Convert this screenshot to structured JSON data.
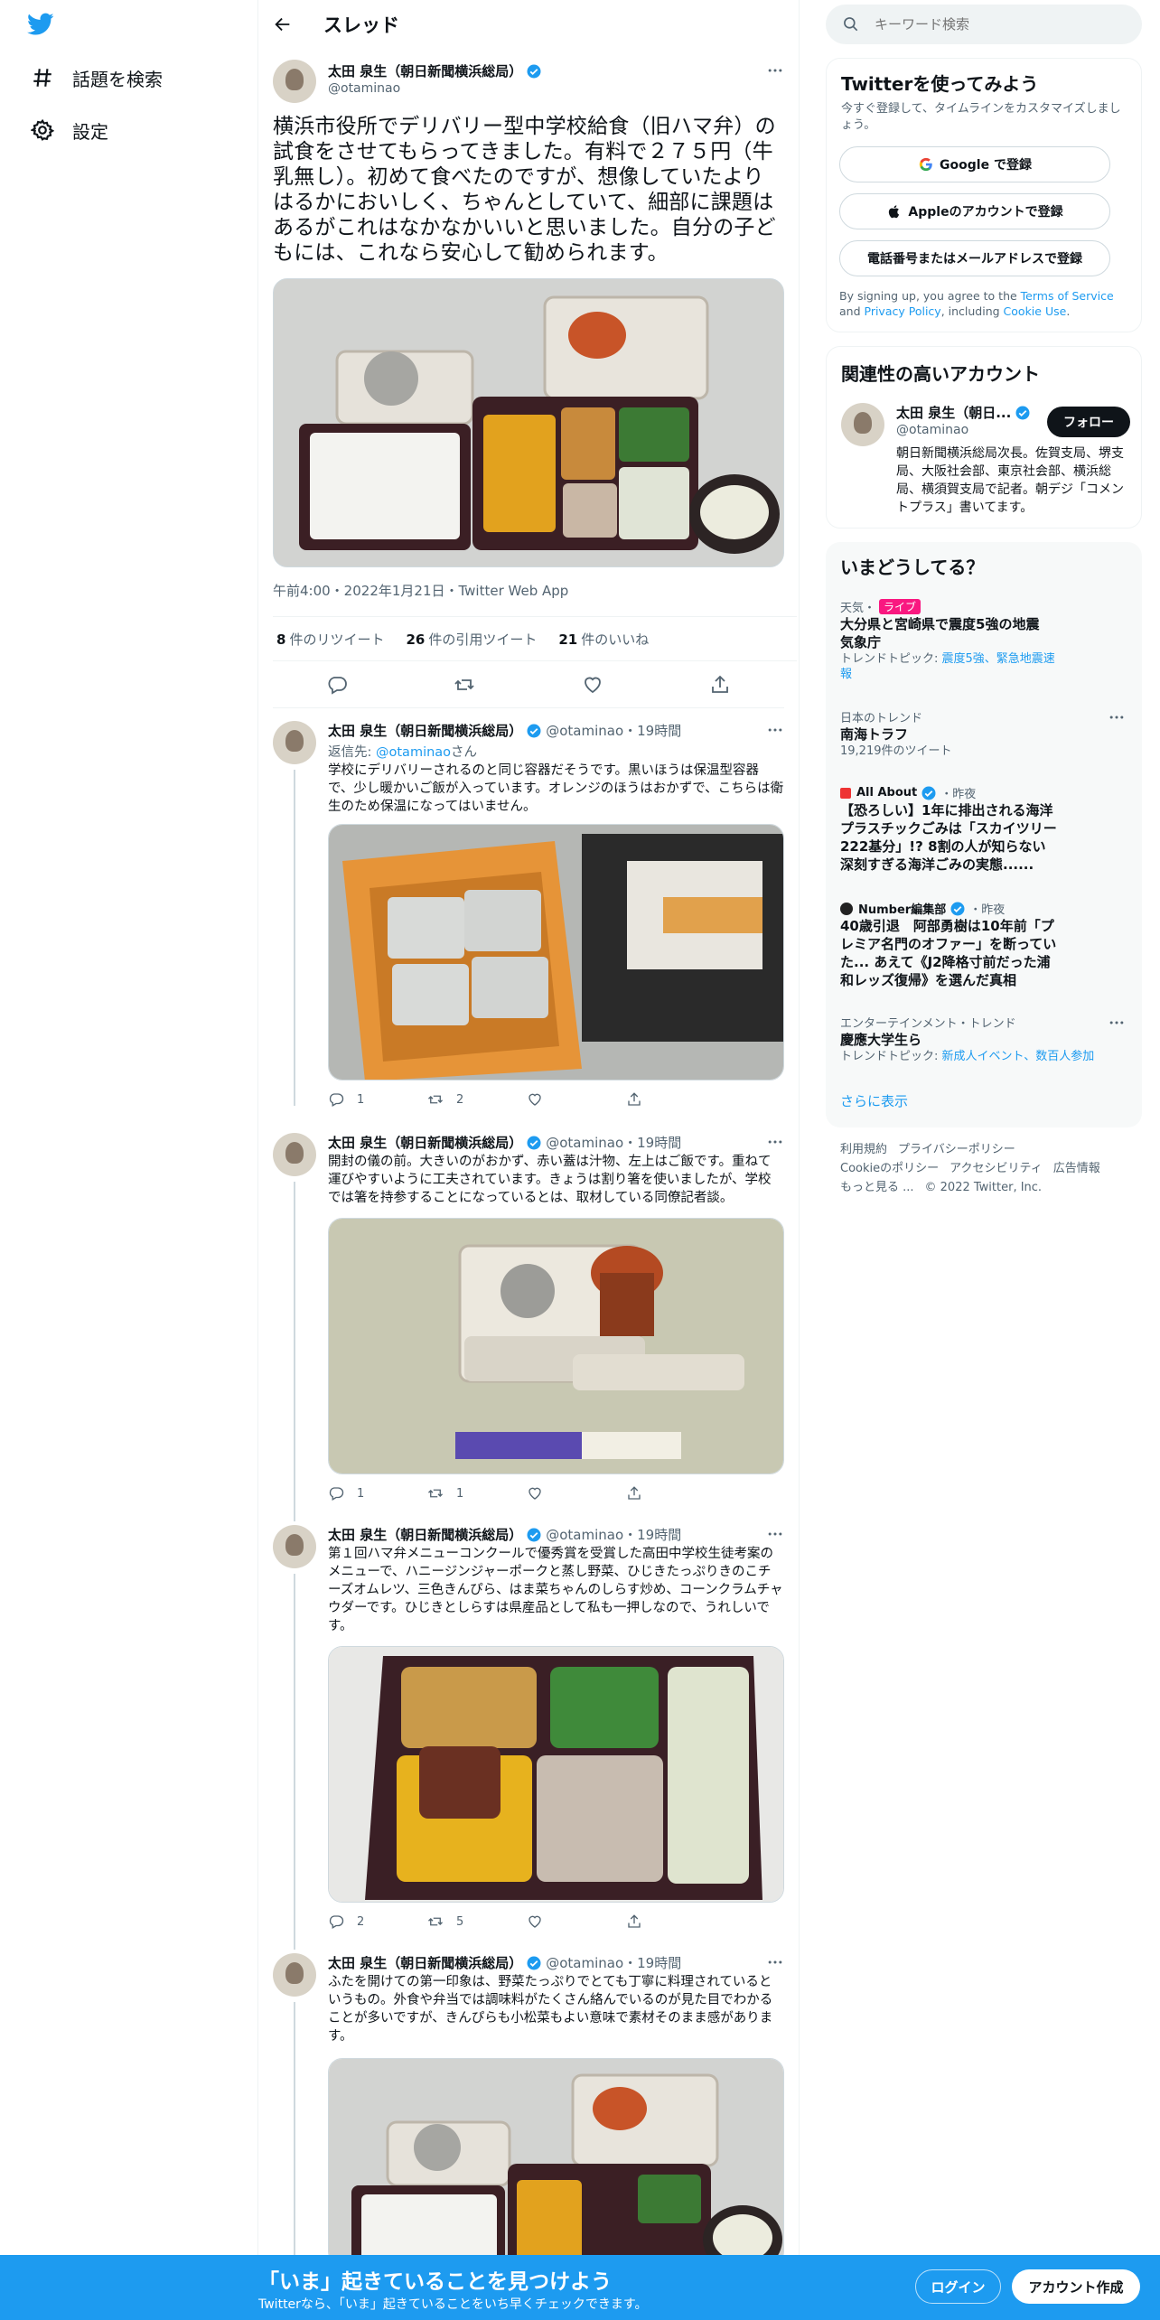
{
  "nav": {
    "explore_label": "話題を検索",
    "settings_label": "設定"
  },
  "header": {
    "title": "スレッド"
  },
  "main_tweet": {
    "author_name": "太田 泉生（朝日新聞横浜総局）",
    "handle": "@otaminao",
    "text": "横浜市役所でデリバリー型中学校給食（旧ハマ弁）の試食をさせてもらってきました。有料で２７５円（牛乳無し）。初めて食べたのですが、想像していたよりはるかにおいしく、ちゃんとしていて、細部に課題はあるがこれはなかなかいいと思いました。自分の子どもには、これなら安心して勧められます。",
    "meta": "午前4:00・2022年1月21日・Twitter Web App",
    "retweets_count": "8",
    "retweets_label": "件のリツイート",
    "quotes_count": "26",
    "quotes_label": "件の引用ツイート",
    "likes_count": "21",
    "likes_label": "件のいいね"
  },
  "replies": [
    {
      "author_name": "太田 泉生（朝日新聞横浜総局）",
      "handle": "@otaminao",
      "time": "・19時間",
      "reply_to_prefix": "返信先: ",
      "reply_to_handle": "@otaminao",
      "reply_to_suffix": "さん",
      "text": "学校にデリバリーされるのと同じ容器だそうです。黒いほうは保温型容器で、少し暖かいご飯が入っています。オレンジのほうはおかずで、こちらは衛生のため保温になってはいません。",
      "replies": "1",
      "retweets": "2",
      "likes": ""
    },
    {
      "author_name": "太田 泉生（朝日新聞横浜総局）",
      "handle": "@otaminao",
      "time": "・19時間",
      "text": "開封の儀の前。大きいのがおかず、赤い蓋は汁物、左上はご飯です。重ねて運びやすいように工夫されています。きょうは割り箸を使いましたが、学校では箸を持参することになっているとは、取材している同僚記者談。",
      "replies": "1",
      "retweets": "1",
      "likes": ""
    },
    {
      "author_name": "太田 泉生（朝日新聞横浜総局）",
      "handle": "@otaminao",
      "time": "・19時間",
      "text": "第１回ハマ弁メニューコンクールで優秀賞を受賞した高田中学校生徒考案のメニューで、ハニージンジャーポークと蒸し野菜、ひじきたっぷりきのこチーズオムレツ、三色きんぴら、はま菜ちゃんのしらす炒め、コーンクラムチャウダーです。ひじきとしらすは県産品として私も一押しなので、うれしいです。",
      "replies": "2",
      "retweets": "5",
      "likes": ""
    },
    {
      "author_name": "太田 泉生（朝日新聞横浜総局）",
      "handle": "@otaminao",
      "time": "・19時間",
      "text": "ふたを開けての第一印象は、野菜たっぷりでとても丁寧に料理されているというもの。外食や弁当では調味料がたくさん絡んでいるのが見た目でわかることが多いですが、きんぴらも小松菜もよい意味で素材そのまま感があります。"
    }
  ],
  "search": {
    "placeholder": "キーワード検索"
  },
  "signup": {
    "title": "Twitterを使ってみよう",
    "subtitle": "今すぐ登録して、タイムラインをカスタマイズしましょう。",
    "google_label": "Google で登録",
    "apple_label": "Appleのアカウントで登録",
    "phone_label": "電話番号またはメールアドレスで登録",
    "terms_prefix": "By signing up, you agree to the ",
    "terms_tos": "Terms of Service",
    "terms_and": " and ",
    "terms_privacy": "Privacy Policy",
    "terms_including": ", including ",
    "terms_cookie": "Cookie Use",
    "terms_end": "."
  },
  "related": {
    "title": "関連性の高いアカウント",
    "name": "太田 泉生（朝日...",
    "handle": "@otaminao",
    "follow_label": "フォロー",
    "bio": "朝日新聞横浜総局次長。佐賀支局、堺支局、大阪社会部、東京社会部、横浜総局、横須賀支局で記者。朝デジ「コメントプラス」書いてます。"
  },
  "trends": {
    "title": "いまどうしてる？",
    "items": [
      {
        "context": "天気・",
        "live": "ライブ",
        "title": "大分県と宮崎県で震度5強の地震　気象庁",
        "extra_prefix": "トレンドトピック: ",
        "extra_links": "震度5強、緊急地震速報"
      },
      {
        "context": "日本のトレンド",
        "title": "南海トラフ",
        "extra": "19,219件のツイート"
      },
      {
        "source": "All About",
        "time": "・昨夜",
        "title": "【恐ろしい】1年に排出される海洋プラスチックごみは「スカイツリー222基分」!? 8割の人が知らない深刻すぎる海洋ごみの実態......"
      },
      {
        "source": "Number編集部",
        "time": "・昨夜",
        "title": "40歳引退　阿部勇樹は10年前「プレミア名門のオファー」を断っていた... あえて《J2降格寸前だった浦和レッズ復帰》を選んだ真相"
      },
      {
        "context": "エンターテインメント・トレンド",
        "title": "慶應大学生ら",
        "extra_prefix": "トレンドトピック: ",
        "extra_links": "新成人イベント、数百人参加"
      }
    ],
    "show_more": "さらに表示"
  },
  "footer": {
    "links": [
      "利用規約",
      "プライバシーポリシー",
      "Cookieのポリシー",
      "アクセシビリティ",
      "広告情報",
      "もっと見る ..."
    ],
    "copyright": "© 2022 Twitter, Inc."
  },
  "bottom_bar": {
    "title": "「いま」起きていることを見つけよう",
    "subtitle": "Twitterなら、「いま」起きていることをいち早くチェックできます。",
    "login_label": "ログイン",
    "signup_label": "アカウント作成"
  },
  "colors": {
    "accent": "#1d9bf0",
    "live": "#f91880",
    "text": "#0f1419",
    "muted": "#536471"
  },
  "icons": [
    "twitter-bird",
    "hashtag",
    "gear",
    "back-arrow",
    "verified-badge",
    "more",
    "reply",
    "retweet",
    "like",
    "share",
    "search",
    "google",
    "apple"
  ]
}
